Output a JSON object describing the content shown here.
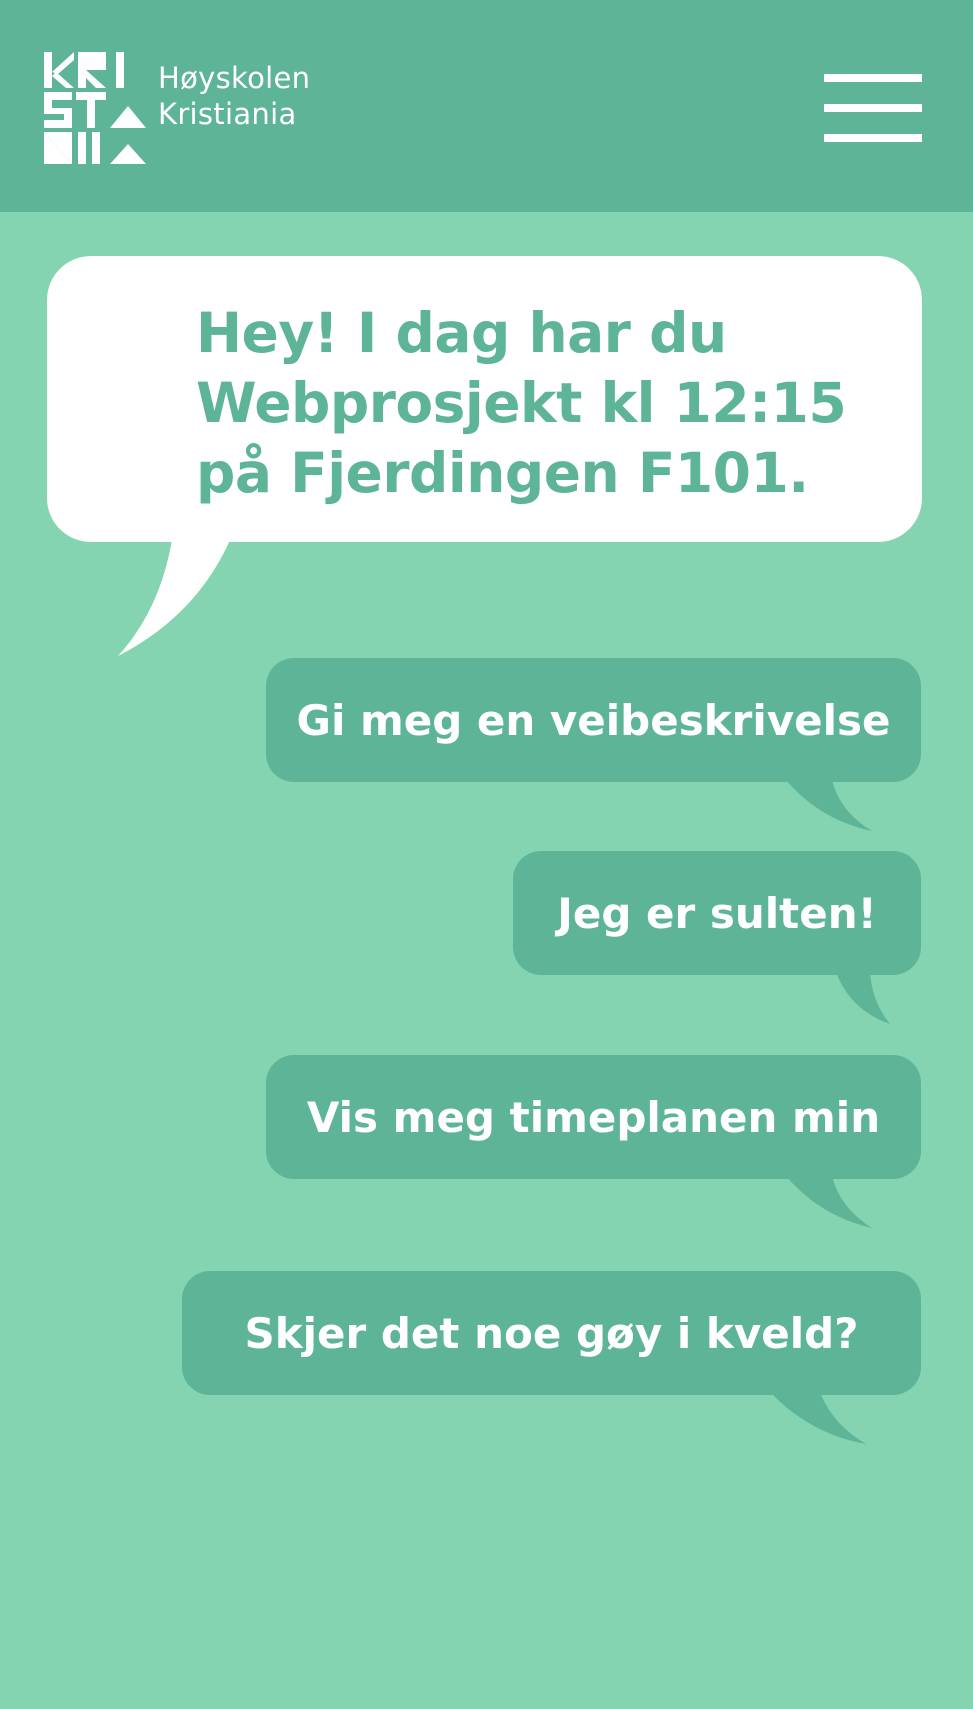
{
  "header": {
    "logo_line1": "Høyskolen",
    "logo_line2": "Kristiania",
    "menu_icon": "hamburger-menu-icon"
  },
  "chat": {
    "greeting_lines": [
      "Hey! I dag har du",
      "Webprosjekt kl 12:15",
      "på Fjerdingen F101."
    ]
  },
  "replies": [
    {
      "label": "Gi meg en veibeskrivelse"
    },
    {
      "label": "Jeg er sulten!"
    },
    {
      "label": "Vis meg timeplanen min"
    },
    {
      "label": "Skjer det noe gøy i kveld?"
    }
  ],
  "colors": {
    "background": "#84d4b2",
    "header": "#5eb497",
    "bubble": "#ffffff",
    "reply": "#5eb497",
    "text_light": "#ffffff",
    "text_accent": "#5eb497"
  }
}
